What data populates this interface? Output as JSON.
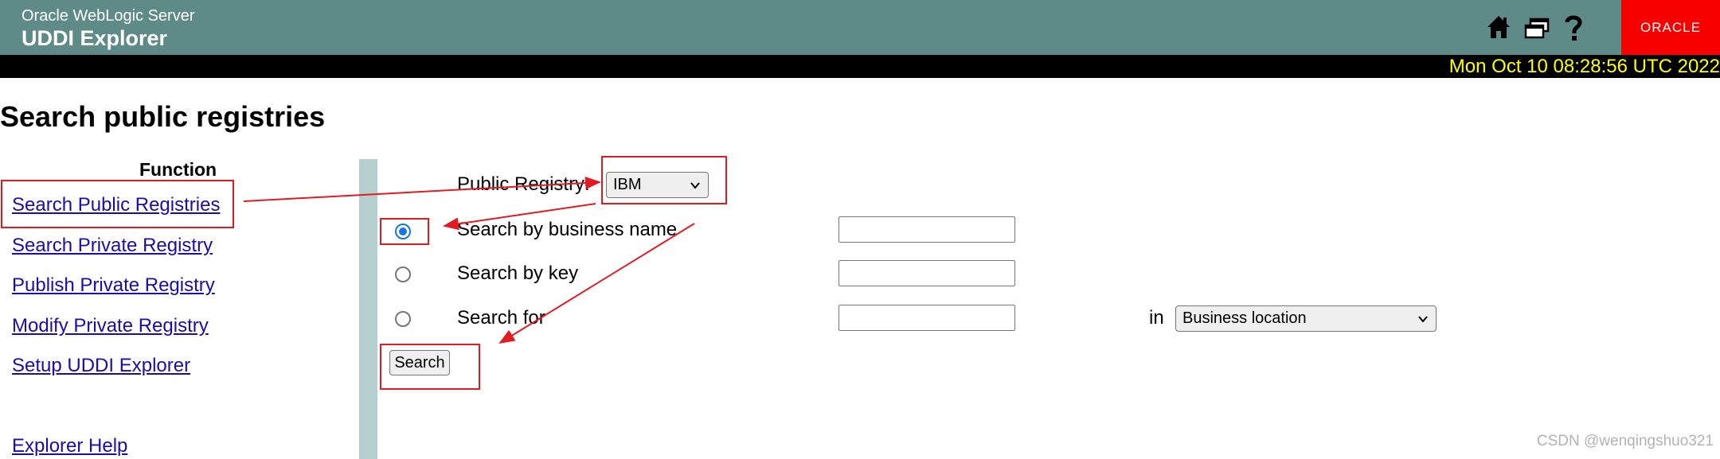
{
  "header": {
    "product": "Oracle WebLogic Server",
    "app": "UDDI Explorer",
    "icons": [
      "home-icon",
      "windows-icon",
      "help-icon"
    ],
    "logo_text": "ORACLE",
    "datetime": "Mon Oct 10 08:28:56 UTC 2022",
    "colors": {
      "header_bg": "#5e8b88",
      "logo_bg": "#f80000",
      "date_text": "#ffff00"
    }
  },
  "page": {
    "title": "Search public registries"
  },
  "sidebar": {
    "heading": "Function",
    "items": [
      {
        "label": "Search Public Registries"
      },
      {
        "label": "Search Private Registry"
      },
      {
        "label": "Publish Private Registry"
      },
      {
        "label": "Modify Private Registry"
      },
      {
        "label": "Setup UDDI Explorer"
      },
      {
        "label": "Explorer Help"
      }
    ]
  },
  "form": {
    "registry_label": "Public Registry:",
    "registry_value": "IBM",
    "options": [
      {
        "label": "Search by business name",
        "checked": true
      },
      {
        "label": "Search by key",
        "checked": false
      },
      {
        "label": "Search for",
        "checked": false
      }
    ],
    "in_label": "in",
    "in_select_value": "Business location",
    "search_button": "Search"
  },
  "watermark": "CSDN @wenqingshuo321"
}
